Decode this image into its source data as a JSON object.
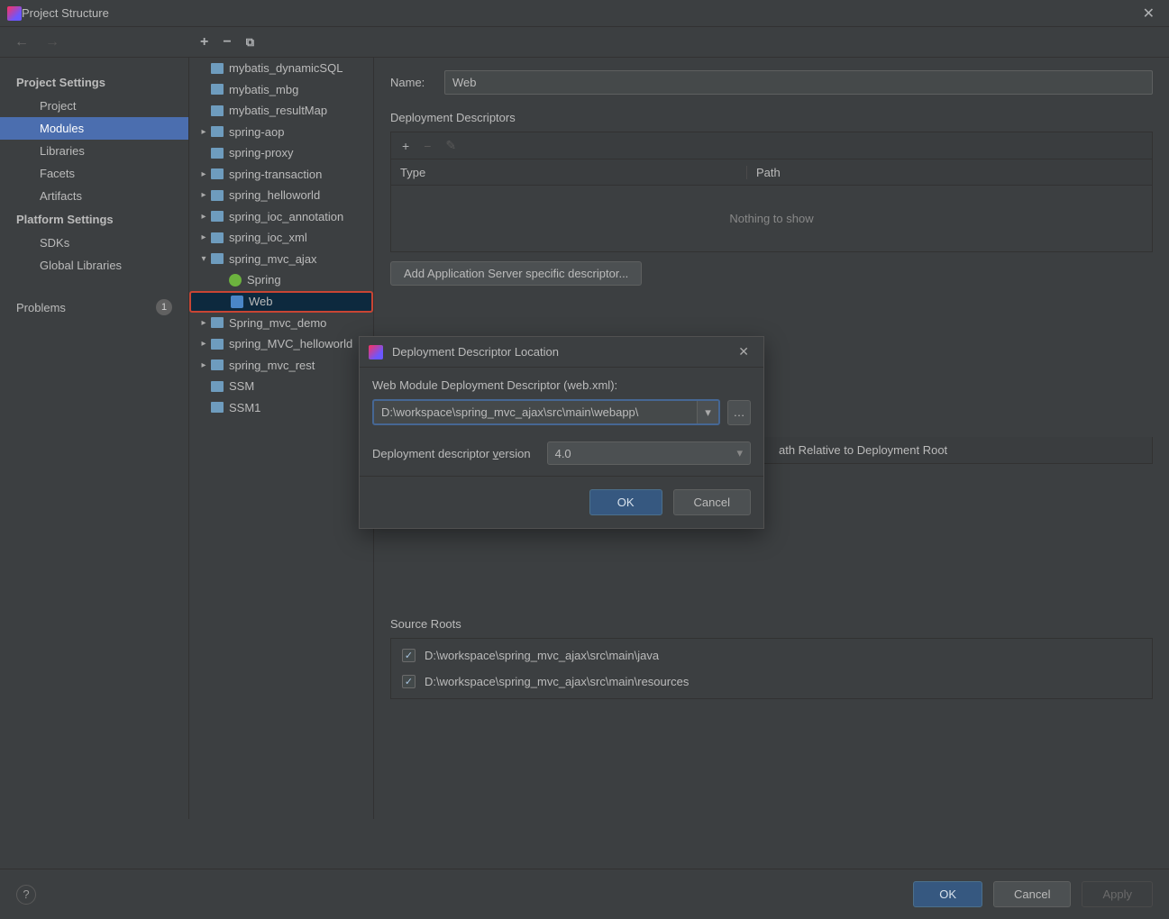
{
  "window": {
    "title": "Project Structure"
  },
  "sidebar": {
    "projectSettings": "Project Settings",
    "items": {
      "project": "Project",
      "modules": "Modules",
      "libraries": "Libraries",
      "facets": "Facets",
      "artifacts": "Artifacts"
    },
    "platformSettings": "Platform Settings",
    "platformItems": {
      "sdks": "SDKs",
      "globalLibs": "Global Libraries"
    },
    "problems": "Problems",
    "problemsCount": "1"
  },
  "tree": [
    {
      "label": "mybatis_dynamicSQL",
      "arrow": "none",
      "icon": "folder",
      "indent": 1
    },
    {
      "label": "mybatis_mbg",
      "arrow": "none",
      "icon": "folder",
      "indent": 1
    },
    {
      "label": "mybatis_resultMap",
      "arrow": "none",
      "icon": "folder",
      "indent": 1
    },
    {
      "label": "spring-aop",
      "arrow": "closed",
      "icon": "folder",
      "indent": 1
    },
    {
      "label": "spring-proxy",
      "arrow": "none",
      "icon": "folder",
      "indent": 1
    },
    {
      "label": "spring-transaction",
      "arrow": "closed",
      "icon": "folder",
      "indent": 1
    },
    {
      "label": "spring_helloworld",
      "arrow": "closed",
      "icon": "folder",
      "indent": 1
    },
    {
      "label": "spring_ioc_annotation",
      "arrow": "closed",
      "icon": "folder",
      "indent": 1
    },
    {
      "label": "spring_ioc_xml",
      "arrow": "closed",
      "icon": "folder",
      "indent": 1
    },
    {
      "label": "spring_mvc_ajax",
      "arrow": "open",
      "icon": "folder",
      "indent": 1
    },
    {
      "label": "Spring",
      "arrow": "none",
      "icon": "spring",
      "indent": 2
    },
    {
      "label": "Web",
      "arrow": "none",
      "icon": "web",
      "indent": 2,
      "selected": true,
      "highlight": true
    },
    {
      "label": "Spring_mvc_demo",
      "arrow": "closed",
      "icon": "folder",
      "indent": 1
    },
    {
      "label": "spring_MVC_helloworld",
      "arrow": "closed",
      "icon": "folder",
      "indent": 1
    },
    {
      "label": "spring_mvc_rest",
      "arrow": "closed",
      "icon": "folder",
      "indent": 1
    },
    {
      "label": "SSM",
      "arrow": "none",
      "icon": "folder",
      "indent": 1
    },
    {
      "label": "SSM1",
      "arrow": "none",
      "icon": "folder",
      "indent": 1
    }
  ],
  "content": {
    "nameLabel": "Name:",
    "nameValue": "Web",
    "ddTitle": "Deployment Descriptors",
    "typeCol": "Type",
    "pathCol": "Path",
    "emptyText": "Nothing to show",
    "addServerBtn": "Add Application Server specific descriptor...",
    "pathRelCol": "ath Relative to Deployment Root",
    "sourceRootsTitle": "Source Roots",
    "sourceRoots": [
      "D:\\workspace\\spring_mvc_ajax\\src\\main\\java",
      "D:\\workspace\\spring_mvc_ajax\\src\\main\\resources"
    ]
  },
  "modal": {
    "title": "Deployment Descriptor Location",
    "fieldLabel": "Web Module Deployment Descriptor (web.xml):",
    "fieldValue": "D:\\workspace\\spring_mvc_ajax\\src\\main\\webapp\\",
    "versionLabel": "Deployment descriptor version",
    "versionValue": "4.0",
    "ok": "OK",
    "cancel": "Cancel"
  },
  "footer": {
    "ok": "OK",
    "cancel": "Cancel",
    "apply": "Apply"
  }
}
